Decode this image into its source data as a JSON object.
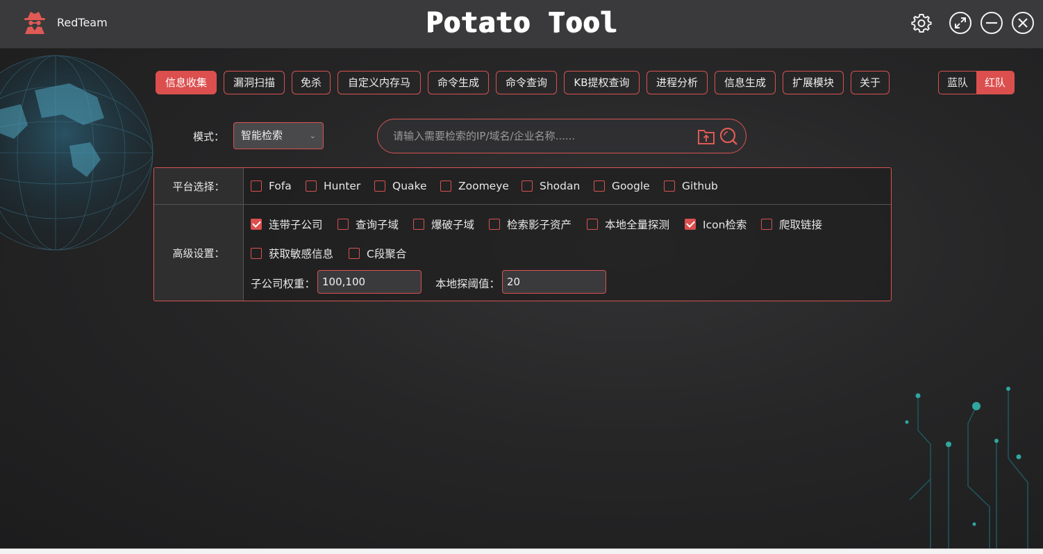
{
  "app": {
    "brand_name": "RedTeam",
    "title": "Potato Tool",
    "accent_color": "#dc4f4f"
  },
  "window_controls": [
    "settings-icon",
    "maximize-icon",
    "minimize-icon",
    "close-icon"
  ],
  "nav": {
    "tabs": [
      {
        "label": "信息收集",
        "active": true
      },
      {
        "label": "漏洞扫描",
        "active": false
      },
      {
        "label": "免杀",
        "active": false
      },
      {
        "label": "自定义内存马",
        "active": false
      },
      {
        "label": "命令生成",
        "active": false
      },
      {
        "label": "命令查询",
        "active": false
      },
      {
        "label": "KB提权查询",
        "active": false
      },
      {
        "label": "进程分析",
        "active": false
      },
      {
        "label": "信息生成",
        "active": false
      },
      {
        "label": "扩展模块",
        "active": false
      },
      {
        "label": "关于",
        "active": false
      }
    ],
    "team": {
      "blue": "蓝队",
      "red": "红队",
      "selected": "红队"
    }
  },
  "search": {
    "mode_label": "模式：",
    "mode_value": "智能检索",
    "placeholder": "请输入需要检索的IP/域名/企业名称......"
  },
  "platform": {
    "label": "平台选择：",
    "options": [
      {
        "label": "Fofa",
        "checked": false
      },
      {
        "label": "Hunter",
        "checked": false
      },
      {
        "label": "Quake",
        "checked": false
      },
      {
        "label": "Zoomeye",
        "checked": false
      },
      {
        "label": "Shodan",
        "checked": false
      },
      {
        "label": "Google",
        "checked": false
      },
      {
        "label": "Github",
        "checked": false
      }
    ]
  },
  "advanced": {
    "label": "高级设置：",
    "options": [
      {
        "label": "连带子公司",
        "checked": true
      },
      {
        "label": "查询子域",
        "checked": false
      },
      {
        "label": "爆破子域",
        "checked": false
      },
      {
        "label": "检索影子资产",
        "checked": false
      },
      {
        "label": "本地全量探测",
        "checked": false
      },
      {
        "label": "Icon检索",
        "checked": true
      },
      {
        "label": "爬取链接",
        "checked": false
      },
      {
        "label": "获取敏感信息",
        "checked": false
      },
      {
        "label": "C段聚合",
        "checked": false
      }
    ],
    "subsidiary_weight_label": "子公司权重：",
    "subsidiary_weight_value": "100,100",
    "probe_threshold_label": "本地探阈值：",
    "probe_threshold_value": "20"
  }
}
